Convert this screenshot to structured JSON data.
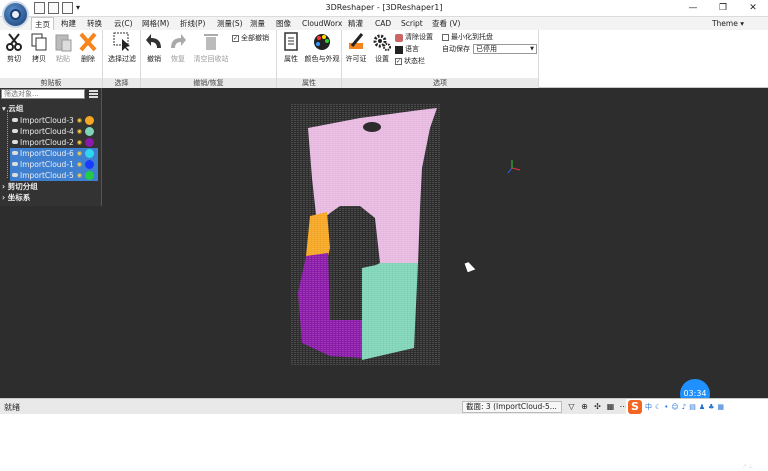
{
  "window": {
    "title": "3DReshaper - [3DReshaper1]",
    "minimize": "—",
    "maximize": "❐",
    "close": "✕"
  },
  "menu": {
    "tabs": [
      "主页",
      "构建",
      "转换",
      "云(C)",
      "网格(M)",
      "折线(P)",
      "测量(S)",
      "测量",
      "图像",
      "CloudWorx",
      "精灌",
      "CAD",
      "Script",
      "查看 (V)"
    ],
    "theme": "Theme ▾"
  },
  "ribbon": {
    "clipboard": {
      "label": "剪贴板",
      "cut": "剪切",
      "copy": "拷贝",
      "paste": "粘贴",
      "delete": "删除"
    },
    "select": {
      "label": "选择",
      "filter": "选择过滤"
    },
    "undo": {
      "label": "撤销/恢复",
      "undo": "撤销",
      "redo": "恢复",
      "clear": "清空回收站",
      "undo_all": "全部撤销"
    },
    "props": {
      "label": "属性",
      "properties": "属性",
      "color": "颜色与外观"
    },
    "options": {
      "label": "选项",
      "license": "许可证",
      "settings": "设置",
      "clear_settings": "清除设置",
      "language": "语言",
      "statusbar": "状态栏",
      "minimize_tray": "最小化到托盘",
      "autosave": "自动保存",
      "autosave_value": "已停用"
    }
  },
  "tree": {
    "filter_placeholder": "筛选对象...",
    "root": "云组",
    "clouds": [
      {
        "name": "ImportCloud-3",
        "color": "#f5a623",
        "selected": false
      },
      {
        "name": "ImportCloud-4",
        "color": "#7fd3b6",
        "selected": false
      },
      {
        "name": "ImportCloud-2",
        "color": "#8b1aa8",
        "selected": false
      },
      {
        "name": "ImportCloud-6",
        "color": "#2fd6f0",
        "selected": true
      },
      {
        "name": "ImportCloud-1",
        "color": "#1a3cff",
        "selected": true
      },
      {
        "name": "ImportCloud-5",
        "color": "#22cc44",
        "selected": true
      }
    ],
    "clipping": "剪切分组",
    "coords": "坐标系"
  },
  "status": {
    "left": "就绪",
    "range": "截面: 3 (ImportCloud-5...",
    "clock": "03:34",
    "tray_lang": "中"
  },
  "colors": {
    "viewport": "#2d2d2d",
    "pink": "#e7b8e0",
    "orange": "#f5a623",
    "purple": "#8b1aa8",
    "teal": "#7fd3b6"
  }
}
